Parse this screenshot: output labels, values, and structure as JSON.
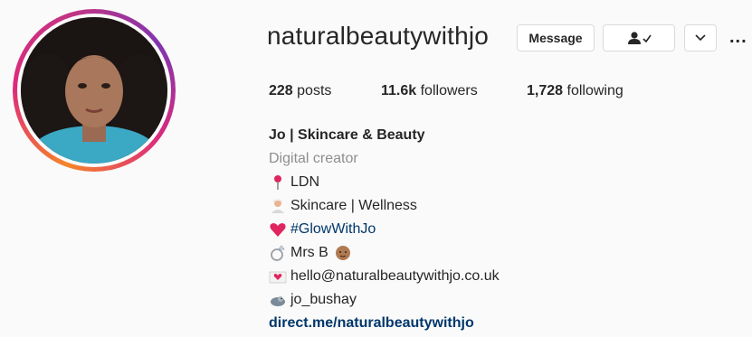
{
  "profile": {
    "username": "naturalbeautywithjo",
    "buttons": {
      "message": "Message",
      "more_options": "..."
    },
    "stats": {
      "posts_count": "228",
      "posts_label": "posts",
      "followers_count": "11.6k",
      "followers_label": "followers",
      "following_count": "1,728",
      "following_label": "following"
    },
    "bio": {
      "name": "Jo | Skincare & Beauty",
      "category": "Digital creator",
      "lines": [
        {
          "icon": "pin-icon",
          "text": "LDN"
        },
        {
          "icon": "spa-person-icon",
          "text": "Skincare | Wellness"
        },
        {
          "icon": "heart-icon",
          "text": "#GlowWithJo"
        },
        {
          "icon": "ring-icon",
          "text": "Mrs B",
          "trailing_icon": "baby-icon"
        },
        {
          "icon": "envelope-icon",
          "text": "hello@naturalbeautywithjo.co.uk"
        },
        {
          "icon": "bird-icon",
          "text": "jo_bushay"
        }
      ],
      "link": "direct.me/naturalbeautywithjo"
    }
  },
  "colors": {
    "background": "#fafafa",
    "text": "#262626",
    "muted": "#8e8e8e",
    "link": "#00376b",
    "border": "#dbdbdb",
    "ring_gradient": [
      "#f58529",
      "#dd2a7b",
      "#8134af"
    ]
  }
}
